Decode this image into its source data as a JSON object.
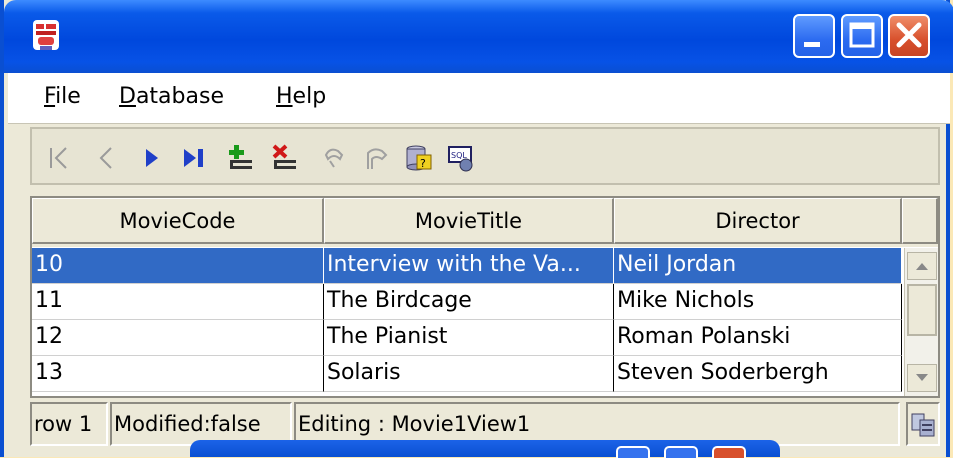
{
  "window": {
    "title": "",
    "controls": {
      "minimize": "minimize",
      "maximize": "maximize",
      "close": "close"
    }
  },
  "menu": {
    "file": {
      "first": "F",
      "rest": "ile"
    },
    "database": {
      "first": "D",
      "rest": "atabase"
    },
    "help": {
      "first": "H",
      "rest": "elp"
    }
  },
  "toolbar": {
    "icons": [
      "first-record-icon",
      "previous-record-icon",
      "next-record-icon",
      "last-record-icon",
      "insert-record-icon",
      "delete-record-icon",
      "commit-icon",
      "rollback-icon",
      "query-icon",
      "sql-icon"
    ]
  },
  "table": {
    "headers": [
      "MovieCode",
      "MovieTitle",
      "Director"
    ],
    "rows": [
      {
        "code": "10",
        "title": "Interview with the Va...",
        "director": "Neil Jordan",
        "selected": true
      },
      {
        "code": "11",
        "title": "The Birdcage",
        "director": "Mike Nichols"
      },
      {
        "code": "12",
        "title": "The Pianist",
        "director": "Roman Polanski"
      },
      {
        "code": "13",
        "title": "Solaris",
        "director": "Steven Soderbergh"
      }
    ]
  },
  "status": {
    "row": "row 1",
    "modified": "Modified:false",
    "editing": "Editing : Movie1View1"
  },
  "colors": {
    "titlebar": "#0a4fd1",
    "selection": "#316ac5",
    "background": "#fbe8b6"
  }
}
